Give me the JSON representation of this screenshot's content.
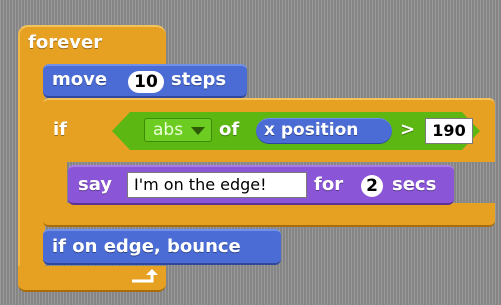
{
  "script": {
    "forever": {
      "label": "forever"
    },
    "move": {
      "label": "move",
      "steps_value": "10",
      "unit_label": "steps"
    },
    "if_block": {
      "label": "if",
      "condition": {
        "function": "abs",
        "of_label": "of",
        "reporter": "x position",
        "operator": ">",
        "threshold": "190"
      }
    },
    "say": {
      "label": "say",
      "message": "I'm on the edge!",
      "for_label": "for",
      "duration": "2",
      "unit_label": "secs"
    },
    "bounce": {
      "label": "if on edge, bounce"
    }
  },
  "colors": {
    "control": "#e6a123",
    "motion": "#4a6cd4",
    "operators": "#5cb712",
    "looks": "#8a55d6",
    "background": "#8d8d8d"
  },
  "icons": {
    "loop_arrow": "loop-arrow-icon",
    "dropdown": "dropdown-arrow-icon"
  }
}
